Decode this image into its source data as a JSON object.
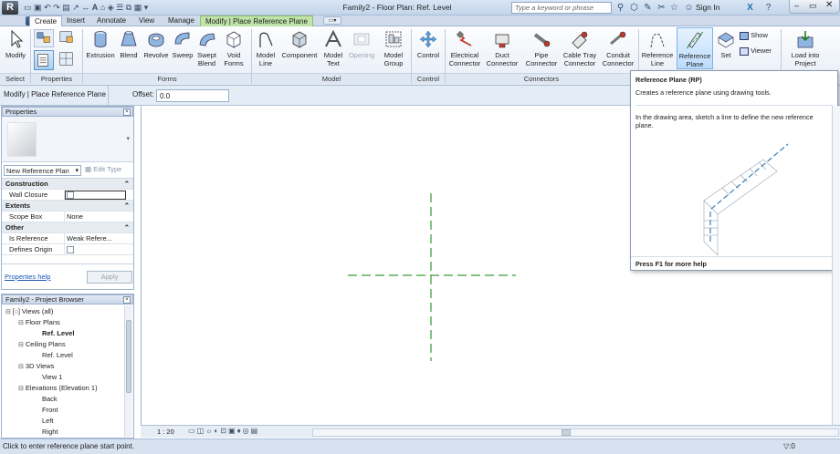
{
  "titlebar": {
    "window_title": "Family2 - Floor Plan: Ref. Level",
    "search_placeholder": "Type a keyword or phrase",
    "sign_in": "Sign In",
    "help": "?"
  },
  "tabs": [
    "Create",
    "Insert",
    "Annotate",
    "View",
    "Manage",
    "Modify | Place Reference Plane"
  ],
  "ribbon": {
    "select": {
      "modify": "Modify",
      "panel": "Select"
    },
    "properties": {
      "panel": "Properties"
    },
    "forms": {
      "items": [
        "Extrusion",
        "Blend",
        "Revolve",
        "Sweep",
        "Swept Blend",
        "Void Forms"
      ],
      "panel": "Forms"
    },
    "model": {
      "items": [
        "Model Line",
        "Component",
        "Model Text",
        "Opening",
        "Model Group"
      ],
      "panel": "Model"
    },
    "control": {
      "items": [
        "Control"
      ],
      "panel": "Control"
    },
    "connectors": {
      "items": [
        "Electrical Connector",
        "Duct Connector",
        "Pipe Connector",
        "Cable Tray Connector",
        "Conduit Connector"
      ],
      "panel": "Connectors"
    },
    "datum": {
      "items": [
        "Reference Line",
        "Reference Plane",
        "Set"
      ],
      "show": "Show",
      "viewer": "Viewer"
    },
    "family_editor": {
      "load": "Load into Project"
    }
  },
  "optbar": {
    "context": "Modify | Place Reference Plane",
    "offset_label": "Offset:",
    "offset_value": "0.0"
  },
  "properties": {
    "title": "Properties",
    "type_selector": "New Reference Plan",
    "edit_type": "Edit Type",
    "groups": [
      {
        "name": "Construction",
        "rows": [
          {
            "label": "Wall Closure",
            "value": ""
          }
        ]
      },
      {
        "name": "Extents",
        "rows": [
          {
            "label": "Scope Box",
            "value": "None"
          }
        ]
      },
      {
        "name": "Other",
        "rows": [
          {
            "label": "Is Reference",
            "value": "Weak Refere..."
          },
          {
            "label": "Defines Origin",
            "value": ""
          }
        ]
      }
    ],
    "help_link": "Properties help",
    "apply": "Apply"
  },
  "browser": {
    "title": "Family2 - Project Browser",
    "items": [
      {
        "label": "Views (all)",
        "level": 0
      },
      {
        "label": "Floor Plans",
        "level": 1
      },
      {
        "label": "Ref. Level",
        "level": 2,
        "bold": true
      },
      {
        "label": "Ceiling Plans",
        "level": 1
      },
      {
        "label": "Ref. Level",
        "level": 2
      },
      {
        "label": "3D Views",
        "level": 1
      },
      {
        "label": "View 1",
        "level": 2
      },
      {
        "label": "Elevations (Elevation 1)",
        "level": 1
      },
      {
        "label": "Back",
        "level": 2
      },
      {
        "label": "Front",
        "level": 2
      },
      {
        "label": "Left",
        "level": 2
      },
      {
        "label": "Right",
        "level": 2
      }
    ]
  },
  "tooltip": {
    "title": "Reference Plane",
    "shortcut": "(RP)",
    "desc": "Creates a reference plane using drawing tools.",
    "detail": "In the drawing area, sketch a line to define the new reference plane.",
    "help": "Press F1 for more help"
  },
  "viewbar": {
    "scale": "1 : 20"
  },
  "status": {
    "message": "Click to enter reference plane start point.",
    "filter": ":0"
  },
  "colors": {
    "refplane": "#3a9a3a",
    "ctx_tab": "#bfe3a9"
  }
}
